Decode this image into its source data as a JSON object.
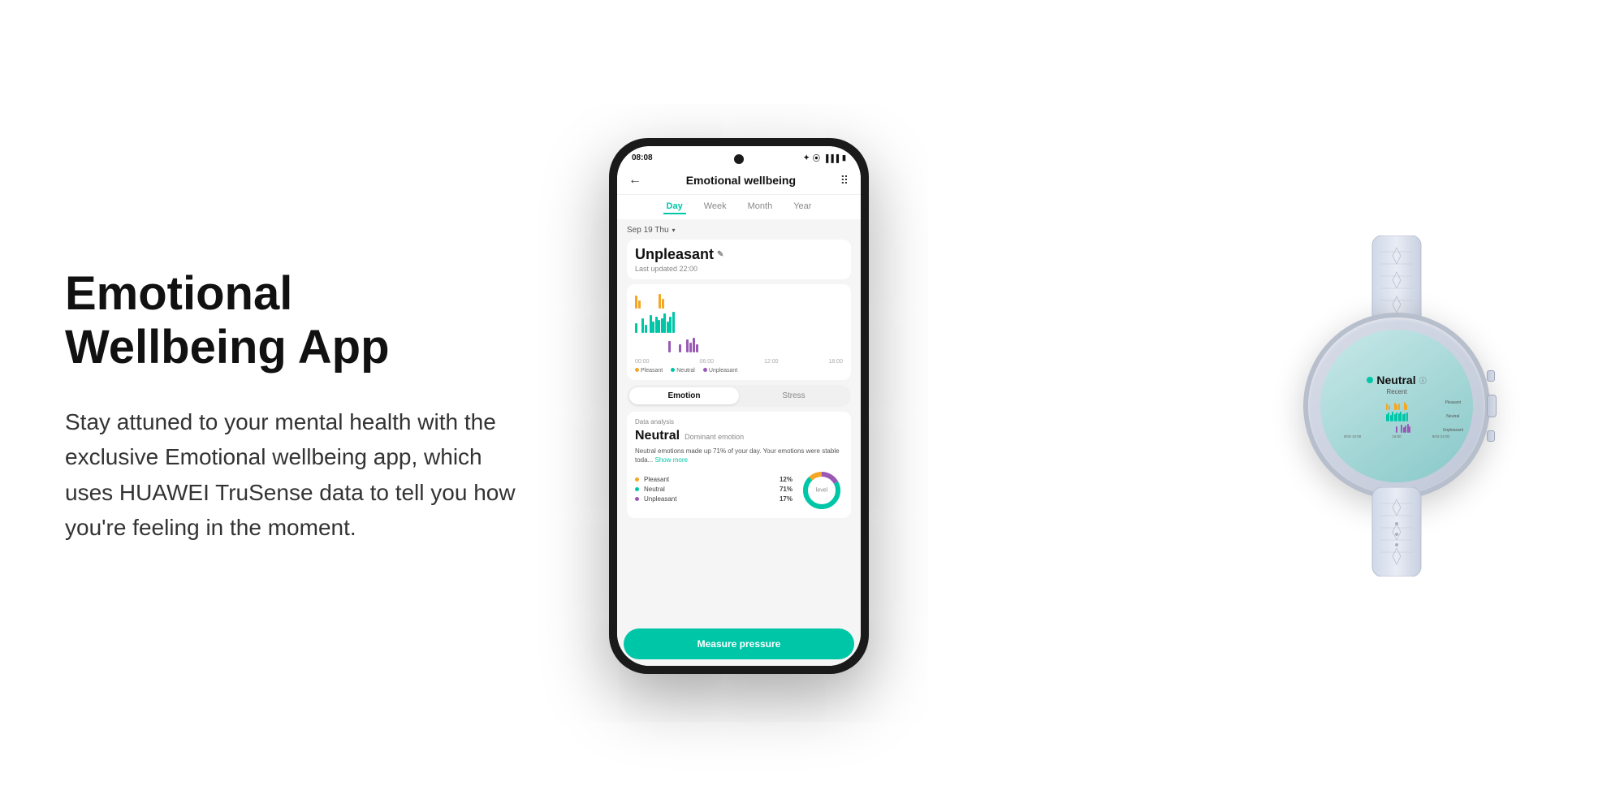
{
  "left": {
    "title": "Emotional Wellbeing App",
    "description": "Stay attuned to your mental health with the exclusive Emotional wellbeing app, which uses HUAWEI TruSense data to tell you how you're feeling in the moment."
  },
  "phone": {
    "status_time": "08:08",
    "app_title": "Emotional wellbeing",
    "tabs": [
      "Day",
      "Week",
      "Month",
      "Year"
    ],
    "active_tab": "Day",
    "date": "Sep 19 Thu",
    "current_emotion": "Unpleasant",
    "last_updated": "Last updated 22:00",
    "time_labels": [
      "00:00",
      "06:00",
      "12:00",
      "18:00"
    ],
    "legend": [
      {
        "label": "Pleasant",
        "color": "#f5a623"
      },
      {
        "label": "Neutral",
        "color": "#00c6a8"
      },
      {
        "label": "Unpleasant",
        "color": "#9b59b6"
      }
    ],
    "toggle": [
      "Emotion",
      "Stress"
    ],
    "active_toggle": "Emotion",
    "analysis_label": "Data analysis",
    "dominant_emotion": "Neutral",
    "dominant_subtitle": "Dominant emotion",
    "analysis_desc": "Neutral emotions made up 71% of your day. Your emotions were stable toda...",
    "show_more": "Show more",
    "breakdown": [
      {
        "label": "Pleasant",
        "pct": "12%",
        "color": "#f5a623"
      },
      {
        "label": "Neutral",
        "pct": "71%",
        "color": "#00c6a8"
      },
      {
        "label": "Unpleasant",
        "pct": "17%",
        "color": "#9b59b6"
      }
    ],
    "donut_label": "level",
    "bottom_button": "Measure pressure"
  },
  "watch": {
    "emotion": "Neutral",
    "recent_label": "Recent",
    "time_labels": [
      "9/19 10:00",
      "16:00",
      "9/19 22:00"
    ],
    "emotion_labels": [
      "Pleasant",
      "Neutral",
      "Unpleasant"
    ]
  }
}
